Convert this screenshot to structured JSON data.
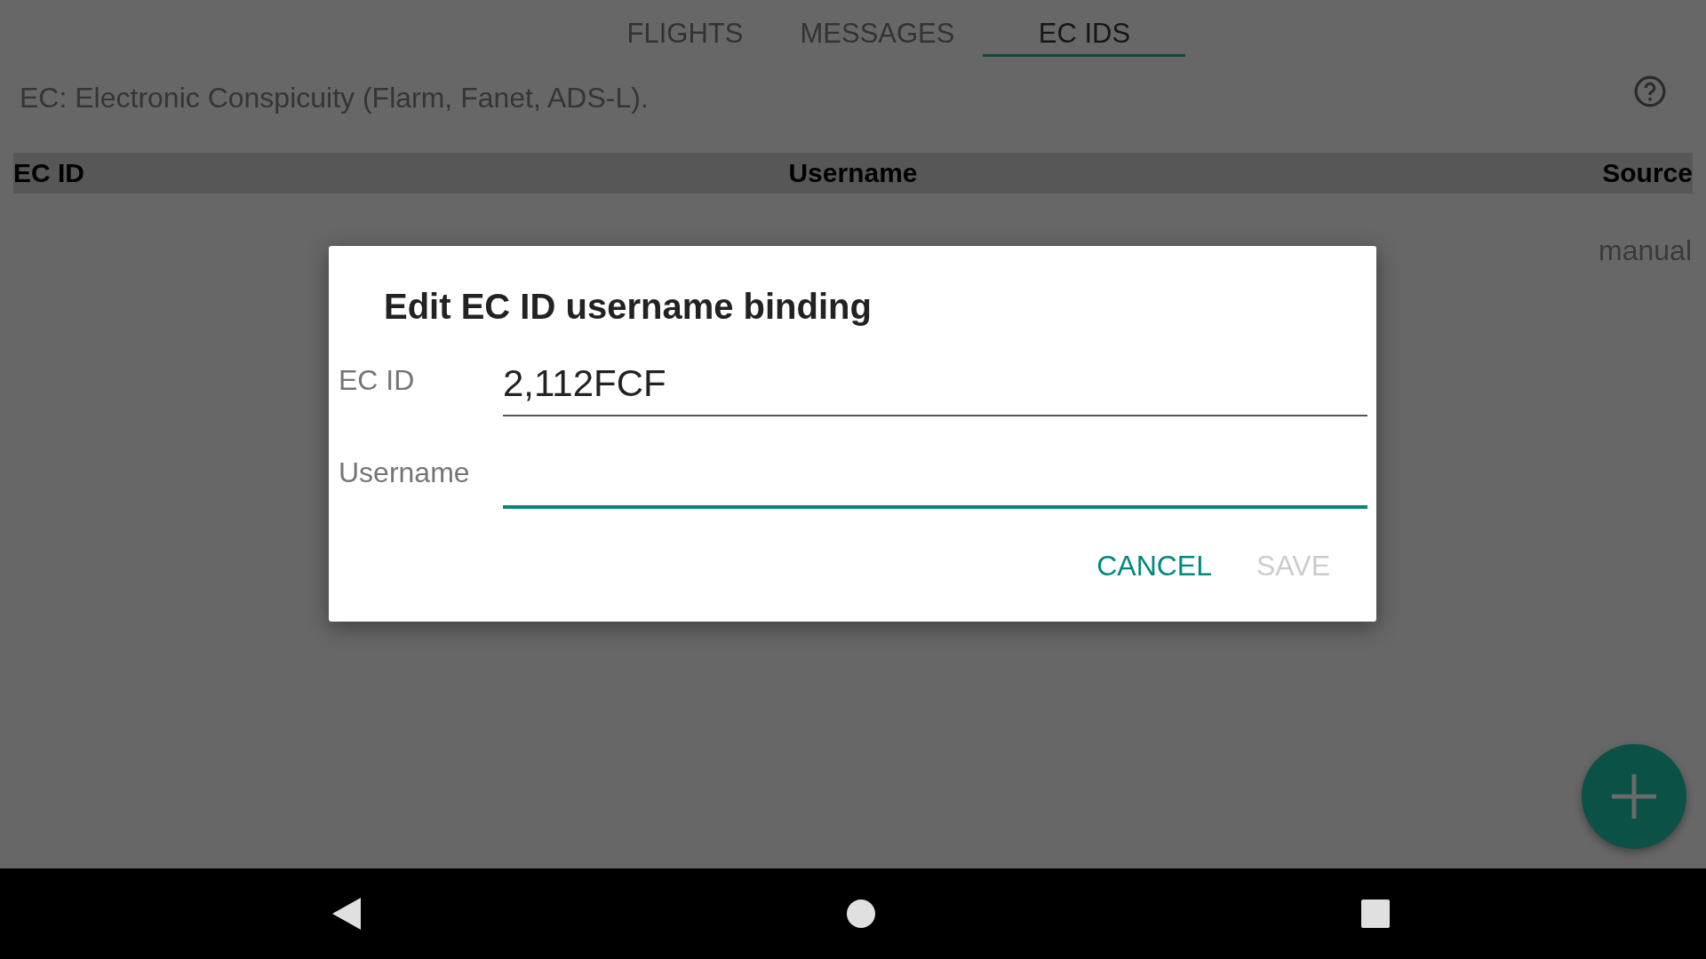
{
  "tabs": [
    {
      "label": "FLIGHTS",
      "selected": false
    },
    {
      "label": "MESSAGES",
      "selected": false
    },
    {
      "label": "EC IDS",
      "selected": true
    }
  ],
  "description": "EC: Electronic Conspicuity (Flarm, Fanet, ADS-L).",
  "table": {
    "columns": [
      "EC ID",
      "Username",
      "Source"
    ],
    "rows": [
      {
        "source": "manual"
      }
    ]
  },
  "dialog": {
    "title": "Edit EC ID username binding",
    "fields": [
      {
        "label": "EC ID",
        "value": "2,112FCF",
        "focused": false
      },
      {
        "label": "Username",
        "focused": true
      }
    ],
    "buttons": [
      {
        "label": "CANCEL",
        "disabled": false
      },
      {
        "label": "SAVE",
        "disabled": true
      }
    ]
  }
}
